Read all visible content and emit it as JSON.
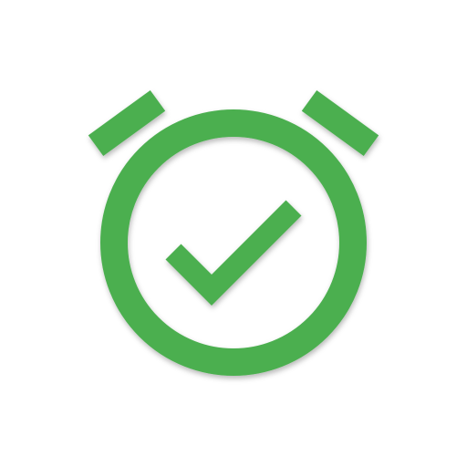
{
  "icon": {
    "name": "alarm-check-icon",
    "color": "#4caf50",
    "background": "#ffffff"
  }
}
